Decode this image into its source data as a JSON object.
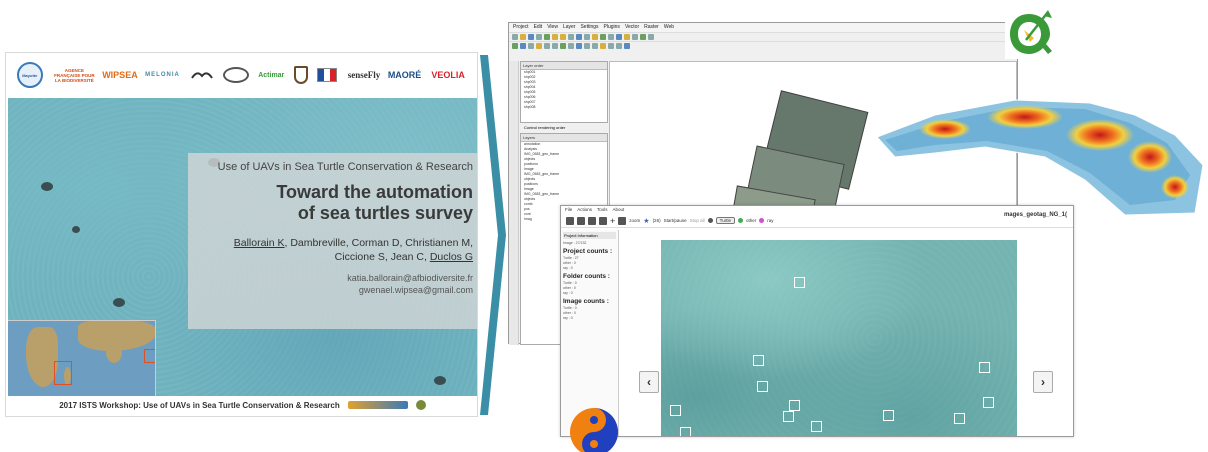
{
  "slide": {
    "logos": [
      {
        "icon": "mayotte-seal-icon",
        "text": "Mayotte"
      },
      {
        "icon": "afb-logo-icon",
        "text": "AGENCE FRANÇAISE POUR LA BIODIVERSITÉ"
      },
      {
        "icon": "wipsea-logo-icon",
        "text": "WIPSEA"
      },
      {
        "icon": "melonia-logo-icon",
        "text": "MELONIA"
      },
      {
        "icon": "bird-logo-icon",
        "text": ""
      },
      {
        "icon": "oval-logo-icon",
        "text": ""
      },
      {
        "icon": "actimar-logo-icon",
        "text": "Actimar"
      },
      {
        "icon": "shield-logo-icon",
        "text": ""
      },
      {
        "icon": "french-republic-logo-icon",
        "text": ""
      },
      {
        "icon": "sensefly-logo-icon",
        "text": "senseFly"
      },
      {
        "icon": "maore-logo-icon",
        "text": "MAORÉ"
      },
      {
        "icon": "veolia-logo-icon",
        "text": "VEOLIA"
      }
    ],
    "subtitle": "Use of UAVs in Sea Turtle Conservation & Research",
    "title_line1": "Toward the automation",
    "title_line2": "of sea turtles survey",
    "authors_1a": "Ballorain K",
    "authors_1b": ", Dambreville, Corman D, Christianen M,",
    "authors_2a": "Ciccione S, Jean C, ",
    "authors_2b": "Duclos G",
    "email_1": "katia.ballorain@afbiodiversite.fr",
    "email_2": "gwenael.wipsea@gmail.com",
    "footer": "2017 ISTS Workshop: Use of UAVs in Sea Turtle Conservation & Research"
  },
  "qgis": {
    "menu": [
      "Project",
      "Edit",
      "View",
      "Layer",
      "Settings",
      "Plugins",
      "Vector",
      "Raster",
      "Web"
    ],
    "layer_order_title": "Layer order",
    "layer_order_items": [
      "shp001",
      "shp002",
      "shp003",
      "shp004",
      "shp005",
      "shp006",
      "shp007",
      "shp008"
    ],
    "control_rendering": "Control rendering order",
    "layers_title": "Layers",
    "layers_items": [
      "annotation",
      "Analysis",
      "IMG_0583_geo_frame",
      "objects",
      "positions",
      "Image",
      "IMG_0583_geo_frame",
      "objects",
      "positions",
      "Image",
      "IMG_0583_geo_frame",
      "objects",
      "comb",
      "pos",
      "cont",
      "Imag"
    ]
  },
  "app": {
    "menu": [
      "File",
      "Actions",
      "Tools",
      "About"
    ],
    "toolbar_labels": [
      "zoom",
      "(26)",
      "Start/pause",
      "Stop all",
      "Turtle",
      "other",
      "ray"
    ],
    "window_title": "mages_geotag_NG_1(",
    "info_header": "Project Information",
    "image_label": "Image : 27/132",
    "project_counts": "Project counts :",
    "project_lines": [
      "Turtle : 27",
      "other : 0",
      "ray : 0"
    ],
    "folder_counts": "Folder counts :",
    "folder_lines": [
      "Turtle : 0",
      "other : 0",
      "ray : 0"
    ],
    "image_counts": "Image counts :",
    "image_lines": [
      "Turtle : 0",
      "other : 0",
      "ray : 0"
    ],
    "prev": "‹",
    "next": "›"
  },
  "colors": {
    "arrow": "#3a8fa6",
    "title_box": "#d2d6d6",
    "qgis_green": "#3a9a3a",
    "qgis_yellow": "#f0c020",
    "yinyang_orange": "#f08010",
    "yinyang_blue": "#2040c0",
    "turtle_dot": "#3fb050",
    "other_dot": "#d050d0"
  }
}
